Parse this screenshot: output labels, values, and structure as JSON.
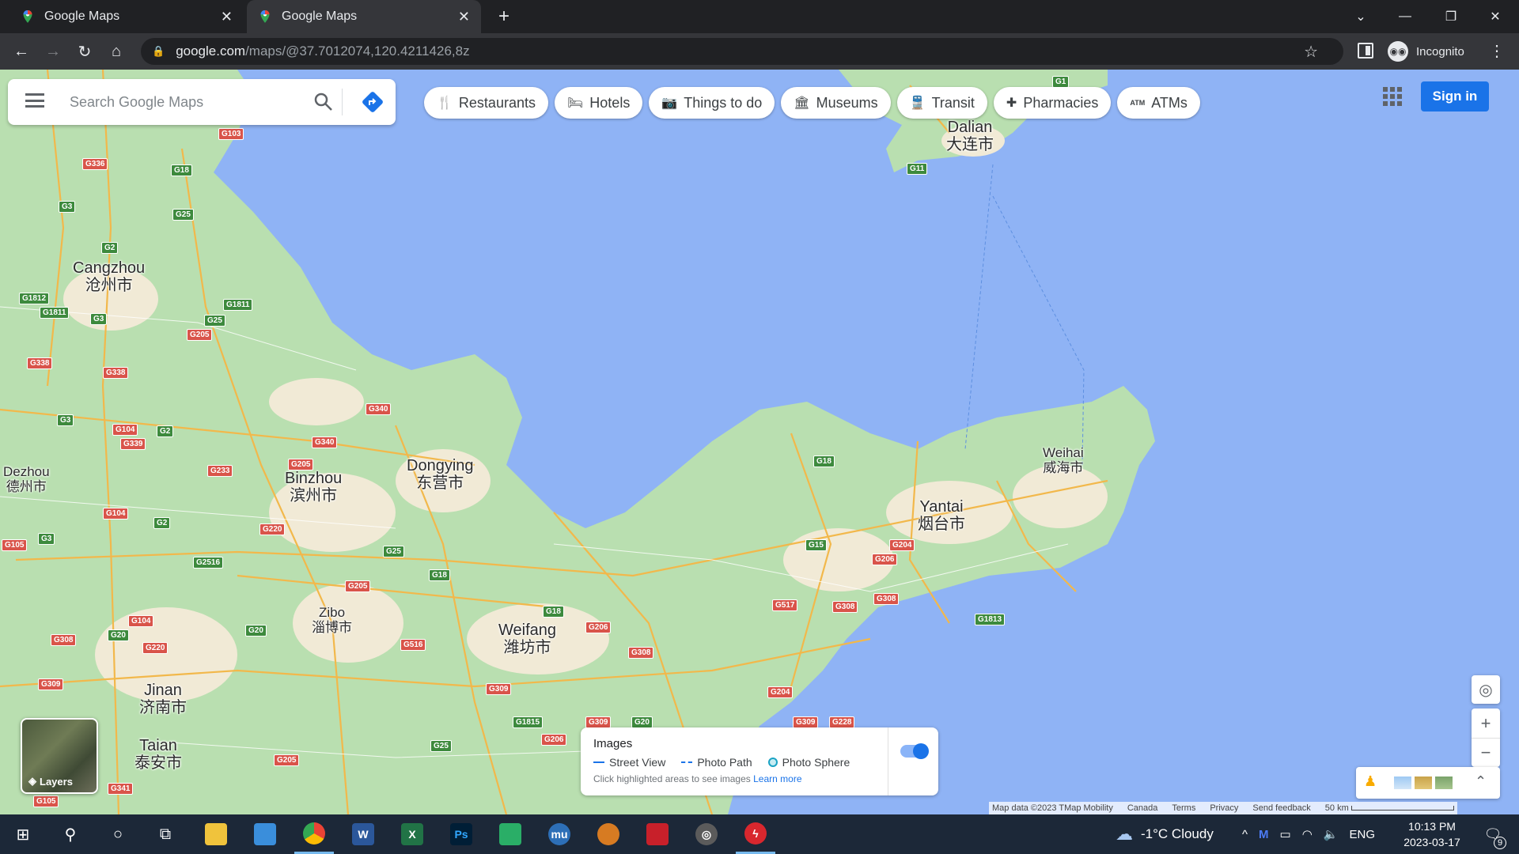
{
  "browser": {
    "tabs": [
      {
        "title": "Google Maps",
        "active": false
      },
      {
        "title": "Google Maps",
        "active": true
      }
    ],
    "url_host": "google.com",
    "url_path": "/maps/@37.7012074,120.4211426,8z",
    "profile": "Incognito"
  },
  "search": {
    "placeholder": "Search Google Maps"
  },
  "chips": [
    {
      "label": "Restaurants",
      "icon": "fork-knife-icon"
    },
    {
      "label": "Hotels",
      "icon": "bed-icon"
    },
    {
      "label": "Things to do",
      "icon": "camera-icon"
    },
    {
      "label": "Museums",
      "icon": "museum-icon"
    },
    {
      "label": "Transit",
      "icon": "train-icon"
    },
    {
      "label": "Pharmacies",
      "icon": "pharmacy-icon"
    },
    {
      "label": "ATMs",
      "icon": "atm-icon"
    }
  ],
  "header": {
    "signin": "Sign in"
  },
  "places": [
    {
      "en": "Dalian",
      "cn": "大连市"
    },
    {
      "en": "Cangzhou",
      "cn": "沧州市"
    },
    {
      "en": "Dezhou",
      "cn": "德州市"
    },
    {
      "en": "Binzhou",
      "cn": "滨州市"
    },
    {
      "en": "Dongying",
      "cn": "东营市"
    },
    {
      "en": "Zibo",
      "cn": "淄博市"
    },
    {
      "en": "Weifang",
      "cn": "潍坊市"
    },
    {
      "en": "Jinan",
      "cn": "济南市"
    },
    {
      "en": "Taian",
      "cn": "泰安市"
    },
    {
      "en": "Yantai",
      "cn": "烟台市"
    },
    {
      "en": "Weihai",
      "cn": "威海市"
    }
  ],
  "shields": [
    "G1",
    "G11",
    "G103",
    "G336",
    "G18",
    "G3",
    "G25",
    "G2",
    "G1812",
    "G1811",
    "G3",
    "G25",
    "G1811",
    "G205",
    "G338",
    "G338",
    "G3",
    "G104",
    "G2",
    "G339",
    "G340",
    "G340",
    "G205",
    "G233",
    "G104",
    "G2",
    "G220",
    "G105",
    "G3",
    "G2516",
    "G25",
    "G18",
    "G205",
    "G104",
    "G20",
    "G308",
    "G220",
    "G20",
    "G516",
    "G18",
    "G206",
    "G308",
    "G309",
    "G1815",
    "G309",
    "G20",
    "G25",
    "G206",
    "G205",
    "G105",
    "G341",
    "G309",
    "G18",
    "G15",
    "G204",
    "G206",
    "G517",
    "G308",
    "G308",
    "G1813",
    "G204",
    "G309",
    "G228",
    "G11"
  ],
  "layers": {
    "label": "Layers"
  },
  "imagery": {
    "title": "Images",
    "street_view": "Street View",
    "photo_path": "Photo Path",
    "photo_sphere": "Photo Sphere",
    "hint": "Click highlighted areas to see images",
    "learn_more": "Learn more"
  },
  "footer": {
    "map_data": "Map data ©2023 TMap Mobility",
    "region": "Canada",
    "terms": "Terms",
    "privacy": "Privacy",
    "feedback": "Send feedback",
    "scale": "50 km"
  },
  "taskbar": {
    "weather": "-1°C  Cloudy",
    "language": "ENG",
    "time": "10:13 PM",
    "date": "2023-03-17",
    "notifications": "9"
  },
  "colors": {
    "water": "#8fb3f5",
    "land": "#b9dfb0",
    "urban": "#f1ead6",
    "accent": "#1a73e8",
    "taskbar": "#1c2838"
  }
}
